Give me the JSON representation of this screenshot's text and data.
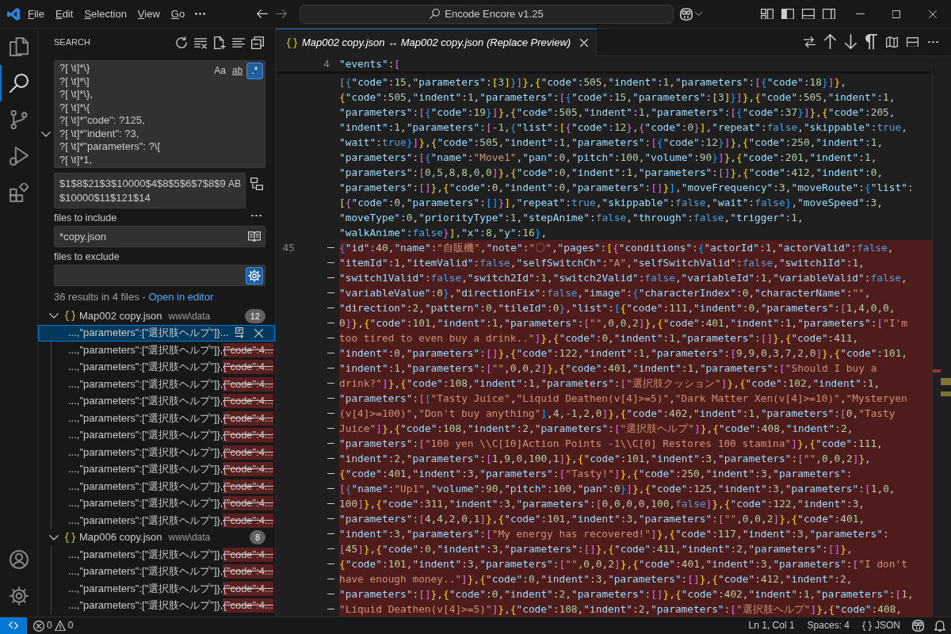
{
  "title_bar": {
    "menus": [
      "File",
      "Edit",
      "Selection",
      "View",
      "Go"
    ],
    "command_center": "Encode Encore v1.25"
  },
  "activity_bar": {
    "items": [
      {
        "kind": "explorer",
        "selected": false
      },
      {
        "kind": "search",
        "selected": true
      },
      {
        "kind": "source_control",
        "selected": false
      },
      {
        "kind": "run_debug",
        "selected": false
      },
      {
        "kind": "extensions",
        "selected": false
      }
    ]
  },
  "sidebar": {
    "title": "SEARCH",
    "search": {
      "query_lines": [
        "?[ \\t]*\\}",
        "?[ \\t]*\\]",
        "?[ \\t]*\\},",
        "?[ \\t]*\\{",
        "?[ \\t]*\"code\": ?125,",
        "?[ \\t]*\"indent\": ?3,",
        "?[ \\t]*\"parameters\": ?\\[",
        "?[ \\t]*1,"
      ],
      "options": [
        {
          "label": "Aa",
          "on": false
        },
        {
          "label": "ab",
          "on": false
        },
        {
          "label": ".*",
          "on": true
        }
      ]
    },
    "replace": {
      "expanded": true,
      "value": "$1$8$21$3$10000$4$8$5$6$7$8$9$10000$11$121$14",
      "options": [
        {
          "label": "AB",
          "on": false
        }
      ]
    },
    "include": {
      "label": "files to include",
      "value": "*copy.json",
      "only_open_editors": false
    },
    "exclude": {
      "label": "files to exclude",
      "use_exclude_settings": true
    },
    "summary": "36 results in 4 files -",
    "summary_link": "Open in editor",
    "files": [
      {
        "name": "Map002 copy.json",
        "path": "www\\data",
        "count": "12",
        "expanded": true,
        "matches": [
          {
            "text": "...,\"parameters\":[\"選択肢ヘルプ\"]}...",
            "selected": true
          },
          {
            "text": "...,\"parameters\":[\"選択肢ヘルプ\"]},",
            "removed": "{\"code\":4...",
            "selected": false
          },
          {
            "text": "...,\"parameters\":[\"選択肢ヘルプ\"]},",
            "removed": "{\"code\":4...",
            "selected": false
          },
          {
            "text": "...,\"parameters\":[\"選択肢ヘルプ\"]},",
            "removed": "{\"code\":4...",
            "selected": false
          },
          {
            "text": "...,\"parameters\":[\"選択肢ヘルプ\"]},",
            "removed": "{\"code\":4...",
            "selected": false
          },
          {
            "text": "...,\"parameters\":[\"選択肢ヘルプ\"]},",
            "removed": "{\"code\":4...",
            "selected": false
          },
          {
            "text": "...,\"parameters\":[\"選択肢ヘルプ\"]},",
            "removed": "{\"code\":4...",
            "selected": false
          },
          {
            "text": "...,\"parameters\":[\"選択肢ヘルプ\"]},",
            "removed": "{\"code\":4...",
            "selected": false
          },
          {
            "text": "...,\"parameters\":[\"選択肢ヘルプ\"]},",
            "removed": "{\"code\":4...",
            "selected": false
          },
          {
            "text": "...,\"parameters\":[\"選択肢ヘルプ\"]},",
            "removed": "{\"code\":4...",
            "selected": false
          },
          {
            "text": "...,\"parameters\":[\"選択肢ヘルプ\"]},",
            "removed": "{\"code\":4...",
            "selected": false
          },
          {
            "text": "...,\"parameters\":[\"選択肢ヘルプ\"]},",
            "removed": "{\"code\":4...",
            "selected": false
          }
        ]
      },
      {
        "name": "Map006 copy.json",
        "path": "www\\data",
        "count": "8",
        "expanded": true,
        "matches": [
          {
            "text": "...,\"parameters\":[\"選択肢ヘルプ\"]},",
            "removed": "{\"code\":4...",
            "selected": false
          },
          {
            "text": "...,\"parameters\":[\"選択肢ヘルプ\"]},",
            "removed": "{\"code\":4...",
            "selected": false
          },
          {
            "text": "...,\"parameters\":[\"選択肢ヘルプ\"]},",
            "removed": "{\"code\":4...",
            "selected": false
          },
          {
            "text": "...,\"parameters\":[\"選択肢ヘルプ\"]},",
            "removed": "{\"code\":4...",
            "selected": false
          }
        ]
      }
    ]
  },
  "editor": {
    "tabs": [
      {
        "title": "Map002 copy.json ↔ Map002 copy.json (Replace Preview)",
        "selected": true,
        "preview": true
      }
    ],
    "sticky_line": {
      "number": "4",
      "text": "\"events\":["
    },
    "rows": [
      {
        "kind": "context",
        "text": "[{\"code\":15,\"parameters\":[3]}]},{\"code\":505,\"indent\":1,\"parameters\":[{\"code\":18}]},"
      },
      {
        "kind": "context",
        "text": "{\"code\":505,\"indent\":1,\"parameters\":[{\"code\":15,\"parameters\":[3]}]},{\"code\":505,\"indent\":1,"
      },
      {
        "kind": "context",
        "text": "\"parameters\":[{\"code\":19}]},{\"code\":505,\"indent\":1,\"parameters\":[{\"code\":37}]},{\"code\":205,"
      },
      {
        "kind": "context",
        "text": "\"indent\":1,\"parameters\":[-1,{\"list\":[{\"code\":12},{\"code\":0}],\"repeat\":false,\"skippable\":true,"
      },
      {
        "kind": "context",
        "text": "\"wait\":true}]},{\"code\":505,\"indent\":1,\"parameters\":[{\"code\":12}]},{\"code\":250,\"indent\":1,"
      },
      {
        "kind": "context",
        "text": "\"parameters\":[{\"name\":\"Move1\",\"pan\":0,\"pitch\":100,\"volume\":90}]},{\"code\":201,\"indent\":1,"
      },
      {
        "kind": "context",
        "text": "\"parameters\":[0,5,8,8,0,0]},{\"code\":0,\"indent\":1,\"parameters\":[]},{\"code\":412,\"indent\":0,"
      },
      {
        "kind": "context",
        "text": "\"parameters\":[]},{\"code\":0,\"indent\":0,\"parameters\":[]}],\"moveFrequency\":3,\"moveRoute\":{\"list\":"
      },
      {
        "kind": "context",
        "text": "[{\"code\":0,\"parameters\":[]}],\"repeat\":true,\"skippable\":false,\"wait\":false},\"moveSpeed\":3,"
      },
      {
        "kind": "context",
        "text": "\"moveType\":0,\"priorityType\":1,\"stepAnime\":false,\"through\":false,\"trigger\":1,"
      },
      {
        "kind": "context",
        "text": "\"walkAnime\":false}],\"x\":8,\"y\":16},"
      },
      {
        "kind": "removed",
        "number": "45",
        "text": "{\"id\":40,\"name\":\"自販機\",\"note\":\"〇\",\"pages\":[{\"conditions\":{\"actorId\":1,\"actorValid\":false,"
      },
      {
        "kind": "removed",
        "text": "\"itemId\":1,\"itemValid\":false,\"selfSwitchCh\":\"A\",\"selfSwitchValid\":false,\"switch1Id\":1,"
      },
      {
        "kind": "removed",
        "text": "\"switch1Valid\":false,\"switch2Id\":1,\"switch2Valid\":false,\"variableId\":1,\"variableValid\":false,"
      },
      {
        "kind": "removed",
        "text": "\"variableValue\":0},\"directionFix\":false,\"image\":{\"characterIndex\":0,\"characterName\":\"\","
      },
      {
        "kind": "removed",
        "text": "\"direction\":2,\"pattern\":0,\"tileId\":0},\"list\":[{\"code\":111,\"indent\":0,\"parameters\":[1,4,0,0,"
      },
      {
        "kind": "removed",
        "text": "0]},{\"code\":101,\"indent\":1,\"parameters\":[\"\",0,0,2]},{\"code\":401,\"indent\":1,\"parameters\":[\"I'm"
      },
      {
        "kind": "removed",
        "text": "too tired to even buy a drink..\"]},{\"code\":0,\"indent\":1,\"parameters\":[]},{\"code\":411,"
      },
      {
        "kind": "removed",
        "text": "\"indent\":0,\"parameters\":[]},{\"code\":122,\"indent\":1,\"parameters\":[9,9,0,3,7,2,0]},{\"code\":101,"
      },
      {
        "kind": "removed",
        "text": "\"indent\":1,\"parameters\":[\"\",0,0,2]},{\"code\":401,\"indent\":1,\"parameters\":[\"Should I buy a"
      },
      {
        "kind": "removed",
        "text": "drink?\"]},{\"code\":108,\"indent\":1,\"parameters\":[\"選択肢クッション\"]},{\"code\":102,\"indent\":1,"
      },
      {
        "kind": "removed",
        "text": "\"parameters\":[[\"Tasty Juice\",\"Liquid Deathen(v[4]>=5)\",\"Dark Matter Xen(v[4]>=10)\",\"Mysteryen"
      },
      {
        "kind": "removed",
        "text": "(v[4]>=100)\",\"Don't buy anything\"],4,-1,2,0]},{\"code\":402,\"indent\":1,\"parameters\":[0,\"Tasty"
      },
      {
        "kind": "removed",
        "text": "Juice\"]},{\"code\":108,\"indent\":2,\"parameters\":[\"選択肢ヘルプ\"]},{\"code\":408,\"indent\":2,"
      },
      {
        "kind": "removed",
        "text": "\"parameters\":[\"100 yen \\\\C[10]Action Points -1\\\\C[0] Restores 100 stamina\"]},{\"code\":111,"
      },
      {
        "kind": "removed",
        "text": "\"indent\":2,\"parameters\":[1,9,0,100,1]},{\"code\":101,\"indent\":3,\"parameters\":[\"\",0,0,2]},"
      },
      {
        "kind": "removed",
        "text": "{\"code\":401,\"indent\":3,\"parameters\":[\"Tasty!\"]},{\"code\":250,\"indent\":3,\"parameters\":"
      },
      {
        "kind": "removed",
        "text": "[{\"name\":\"Up1\",\"volume\":90,\"pitch\":100,\"pan\":0}]},{\"code\":125,\"indent\":3,\"parameters\":[1,0,"
      },
      {
        "kind": "removed",
        "text": "100]},{\"code\":311,\"indent\":3,\"parameters\":[0,0,0,0,100,false]},{\"code\":122,\"indent\":3,"
      },
      {
        "kind": "removed",
        "text": "\"parameters\":[4,4,2,0,1]},{\"code\":101,\"indent\":3,\"parameters\":[\"\",0,0,2]},{\"code\":401,"
      },
      {
        "kind": "removed",
        "text": "\"indent\":3,\"parameters\":[\"My energy has recovered!\"]},{\"code\":117,\"indent\":3,\"parameters\":"
      },
      {
        "kind": "removed",
        "text": "[45]},{\"code\":0,\"indent\":3,\"parameters\":[]},{\"code\":411,\"indent\":2,\"parameters\":[]},"
      },
      {
        "kind": "removed",
        "text": "{\"code\":101,\"indent\":3,\"parameters\":[\"\",0,0,2]},{\"code\":401,\"indent\":3,\"parameters\":[\"I don't"
      },
      {
        "kind": "removed",
        "text": "have enough money..\"]},{\"code\":0,\"indent\":3,\"parameters\":[]},{\"code\":412,\"indent\":2,"
      },
      {
        "kind": "removed",
        "text": "\"parameters\":[]},{\"code\":0,\"indent\":2,\"parameters\":[]},{\"code\":402,\"indent\":1,\"parameters\":[1,"
      },
      {
        "kind": "removed",
        "text": "\"Liquid Deathen(v[4]>=5)\"]},{\"code\":108,\"indent\":2,\"parameters\":[\"選択肢ヘルプ\"]},{\"code\":408,"
      }
    ]
  },
  "status_bar": {
    "errors": "0",
    "warnings": "0",
    "position": "Ln 1, Col 1",
    "indentation": "Spaces: 4",
    "language": "JSON"
  }
}
